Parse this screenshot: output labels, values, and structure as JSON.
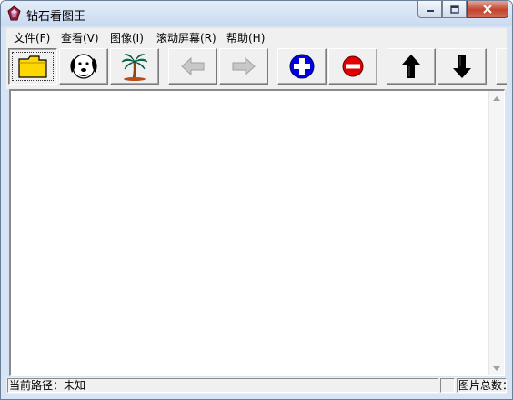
{
  "window": {
    "title": "钻石看图王"
  },
  "menu": [
    {
      "label": "文件(F)"
    },
    {
      "label": "查看(V)"
    },
    {
      "label": "图像(I)"
    },
    {
      "label": "滚动屏幕(R)"
    },
    {
      "label": "帮助(H)"
    }
  ],
  "toolbar": {
    "buttons": [
      {
        "icon": "folder-icon"
      },
      {
        "icon": "dog-icon"
      },
      {
        "icon": "palm-tree-icon"
      },
      {
        "icon": "arrow-left-icon"
      },
      {
        "icon": "arrow-right-icon"
      },
      {
        "icon": "zoom-in-icon"
      },
      {
        "icon": "zoom-out-icon"
      },
      {
        "icon": "arrow-up-icon"
      },
      {
        "icon": "arrow-down-icon"
      }
    ]
  },
  "status": {
    "path": "当前路径：未知",
    "count": "图片总数："
  }
}
